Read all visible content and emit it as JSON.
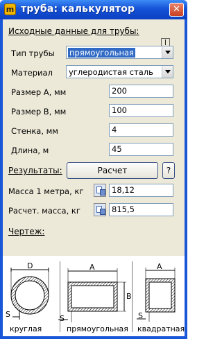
{
  "window": {
    "title": "труба: калькулятор",
    "app_icon_glyph": "m"
  },
  "input_section": {
    "label": "Исходные данные для трубы:"
  },
  "pipe_type": {
    "label": "Тип трубы",
    "value": "прямоугольная"
  },
  "material": {
    "label": "Материал",
    "value": "углеродистая сталь"
  },
  "size_a": {
    "label": "Размер А, мм",
    "value": "200"
  },
  "size_b": {
    "label": "Размер В, мм",
    "value": "100"
  },
  "wall": {
    "label": "Стенка, мм",
    "value": "4"
  },
  "length": {
    "label": "Длина, м",
    "value": "45"
  },
  "results": {
    "label": "Результаты:",
    "calc_button": "Расчет",
    "help_button": "?"
  },
  "mass_per_meter": {
    "label": "Масса 1 метра, кг",
    "value": "18,12"
  },
  "calc_mass": {
    "label": "Расчет. масса, кг",
    "value": "815,5"
  },
  "drawing": {
    "label": "Чертеж:",
    "round": {
      "caption": "круглая",
      "dim_d": "D",
      "dim_s": "S"
    },
    "rect": {
      "caption": "прямоугольная",
      "dim_a": "A",
      "dim_b": "B",
      "dim_s": "S"
    },
    "square": {
      "caption": "квадратная",
      "dim_a": "A",
      "dim_s": "S"
    }
  },
  "colors": {
    "titlebar": "#1552d6",
    "client_bg": "#ece9d8",
    "selection": "#316ac5",
    "close": "#c8401f"
  }
}
